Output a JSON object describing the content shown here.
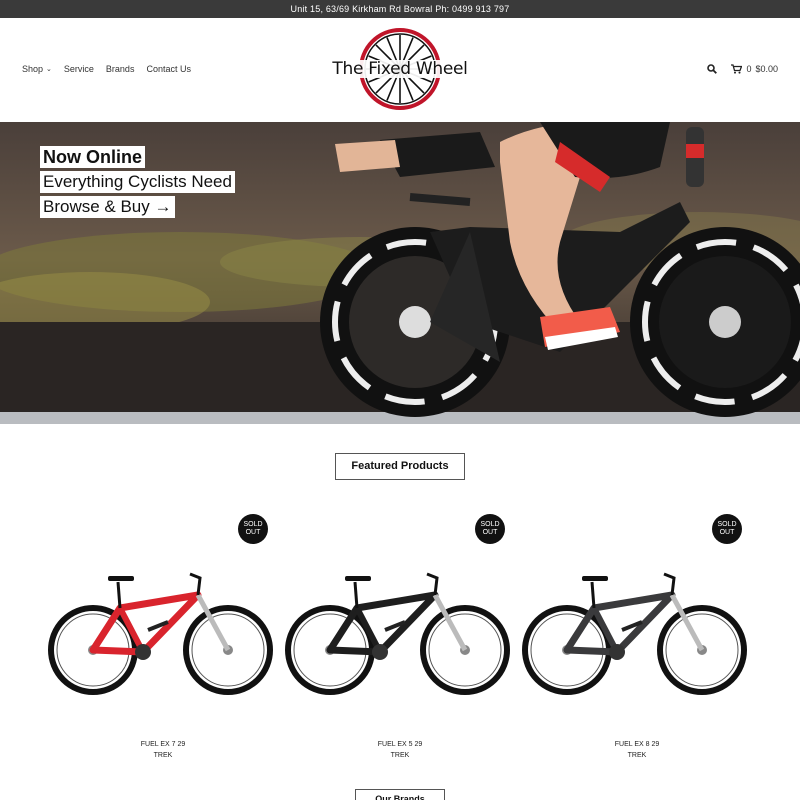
{
  "topbar": {
    "text": "Unit 15, 63/69 Kirkham Rd Bowral Ph: 0499 913 797"
  },
  "nav": [
    {
      "label": "Shop",
      "has_dropdown": true
    },
    {
      "label": "Service"
    },
    {
      "label": "Brands"
    },
    {
      "label": "Contact Us"
    }
  ],
  "logo": {
    "text": "The Fixed Wheel",
    "accent": "#c0152a"
  },
  "cart": {
    "count": "0",
    "total": "$0.00"
  },
  "hero": {
    "line1": "Now Online",
    "line2": "Everything Cyclists Need",
    "line3": "Browse & Buy →"
  },
  "featured": {
    "title": "Featured Products"
  },
  "products": [
    {
      "name": "FUEL EX 7 29",
      "brand": "TREK",
      "badge": "SOLD OUT",
      "frame_color": "#d9242d"
    },
    {
      "name": "FUEL EX 5 29",
      "brand": "TREK",
      "badge": "SOLD OUT",
      "frame_color": "#1e1e1e"
    },
    {
      "name": "FUEL EX 8 29",
      "brand": "TREK",
      "badge": "SOLD OUT",
      "frame_color": "#3a3a3c"
    }
  ],
  "next_section": {
    "title": "Our Brands"
  }
}
